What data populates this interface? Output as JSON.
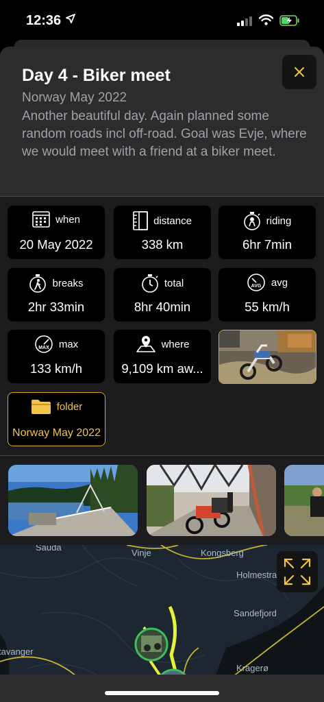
{
  "status": {
    "time": "12:36"
  },
  "header": {
    "title": "Day 4 - Biker meet",
    "subtitle": "Norway May 2022",
    "description": "Another beautiful day. Again planned some random roads incl off-road. Goal was Evje, where we would meet with a friend at a biker meet."
  },
  "stats": {
    "when": {
      "label": "when",
      "value": "20 May 2022",
      "icon": "calendar-icon"
    },
    "distance": {
      "label": "distance",
      "value": "338 km",
      "icon": "ruler-icon"
    },
    "riding": {
      "label": "riding",
      "value": "6hr 7min",
      "icon": "stopwatch-rider-icon"
    },
    "breaks": {
      "label": "breaks",
      "value": "2hr 33min",
      "icon": "stopwatch-walker-icon"
    },
    "total": {
      "label": "total",
      "value": "8hr 40min",
      "icon": "stopwatch-icon"
    },
    "avg": {
      "label": "avg",
      "value": "55 km/h",
      "icon": "speedometer-avg-icon"
    },
    "max": {
      "label": "max",
      "value": "133 km/h",
      "icon": "speedometer-max-icon"
    },
    "where": {
      "label": "where",
      "value": "9,109 km aw...",
      "icon": "map-pin-icon"
    },
    "folder": {
      "label": "folder",
      "value": "Norway May 2022",
      "icon": "folder-icon"
    }
  },
  "map": {
    "labels": [
      "Sauda",
      "Vinje",
      "Kongsberg",
      "Holmestra",
      "Sandefjord",
      "tavanger",
      "Kragerø"
    ]
  },
  "colors": {
    "accent": "#f3c34a",
    "route": "#e6f23a",
    "sheet": "#1c1c1e",
    "header": "#2c2c2e"
  }
}
